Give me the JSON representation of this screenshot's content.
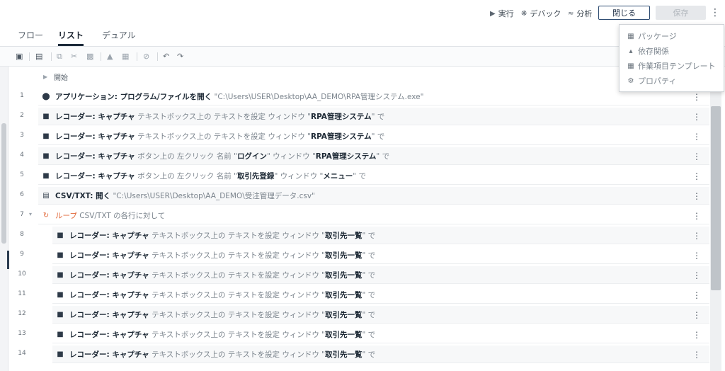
{
  "topbar": {
    "run_label": "実行",
    "debug_label": "デバック",
    "analyze_label": "分析",
    "close_label": "閉じる",
    "save_label": "保存"
  },
  "tabs": [
    {
      "label": "フロー"
    },
    {
      "label": "リスト",
      "active": true
    },
    {
      "label": "デュアル"
    }
  ],
  "dropdown": {
    "items": [
      {
        "label": "パッケージ",
        "icon": "package-icon"
      },
      {
        "label": "依存関係",
        "icon": "dependency-icon"
      },
      {
        "label": "作業項目テンプレート",
        "icon": "table-icon"
      },
      {
        "label": "プロパティ",
        "icon": "gear-icon"
      }
    ]
  },
  "list": {
    "start_label": "開始",
    "rows": [
      {
        "num": "1",
        "icon": "application-icon",
        "parts": [
          "アプリケーション: プログラム/ファイルを開く",
          " \"C:\\Users\\USER\\Desktop\\AA_DEMO\\RPA管理システム.exe\""
        ]
      },
      {
        "num": "2",
        "icon": "recorder-icon",
        "parts": [
          "レコーダー: キャプチャ",
          " テキストボックス上の テキストを設定 ウィンドウ \"",
          "RPA管理システム",
          "\" で"
        ]
      },
      {
        "num": "3",
        "icon": "recorder-icon",
        "parts": [
          "レコーダー: キャプチャ",
          " テキストボックス上の テキストを設定 ウィンドウ \"",
          "RPA管理システム",
          "\" で"
        ]
      },
      {
        "num": "4",
        "icon": "recorder-icon",
        "parts": [
          "レコーダー: キャプチャ",
          " ボタン上の 左クリック 名前 \"",
          "ログイン",
          "\" ウィンドウ \"",
          "RPA管理システム",
          "\" で"
        ]
      },
      {
        "num": "5",
        "icon": "recorder-icon",
        "parts": [
          "レコーダー: キャプチャ",
          " ボタン上の 左クリック 名前 \"",
          "取引先登録",
          "\" ウィンドウ \"",
          "メニュー",
          "\" で"
        ]
      },
      {
        "num": "6",
        "icon": "csv-icon",
        "parts": [
          "CSV/TXT: 開く",
          " \"C:\\Users\\USER\\Desktop\\AA_DEMO\\受注管理データ.csv\""
        ]
      },
      {
        "num": "7",
        "icon": "loop-icon",
        "parts": [
          "ループ",
          " CSV/TXT の各行に対して"
        ]
      },
      {
        "num": "8",
        "icon": "recorder-icon",
        "parts": [
          "レコーダー: キャプチャ",
          " テキストボックス上の テキストを設定 ウィンドウ \"",
          "取引先一覧",
          "\" で"
        ]
      },
      {
        "num": "9",
        "icon": "recorder-icon",
        "parts": [
          "レコーダー: キャプチャ",
          " テキストボックス上の テキストを設定 ウィンドウ \"",
          "取引先一覧",
          "\" で"
        ]
      },
      {
        "num": "10",
        "icon": "recorder-icon",
        "parts": [
          "レコーダー: キャプチャ",
          " テキストボックス上の テキストを設定 ウィンドウ \"",
          "取引先一覧",
          "\" で"
        ]
      },
      {
        "num": "11",
        "icon": "recorder-icon",
        "parts": [
          "レコーダー: キャプチャ",
          " テキストボックス上の テキストを設定 ウィンドウ \"",
          "取引先一覧",
          "\" で"
        ]
      },
      {
        "num": "12",
        "icon": "recorder-icon",
        "parts": [
          "レコーダー: キャプチャ",
          " テキストボックス上の テキストを設定 ウィンドウ \"",
          "取引先一覧",
          "\" で"
        ]
      },
      {
        "num": "13",
        "icon": "recorder-icon",
        "parts": [
          "レコーダー: キャプチャ",
          " テキストボックス上の テキストを設定 ウィンドウ \"",
          "取引先一覧",
          "\" で"
        ]
      },
      {
        "num": "14",
        "icon": "recorder-icon",
        "parts": [
          "レコーダー: キャプチャ",
          " テキストボックス上の テキストを設定 ウィンドウ \"",
          "取引先一覧",
          "\" で"
        ]
      }
    ]
  }
}
